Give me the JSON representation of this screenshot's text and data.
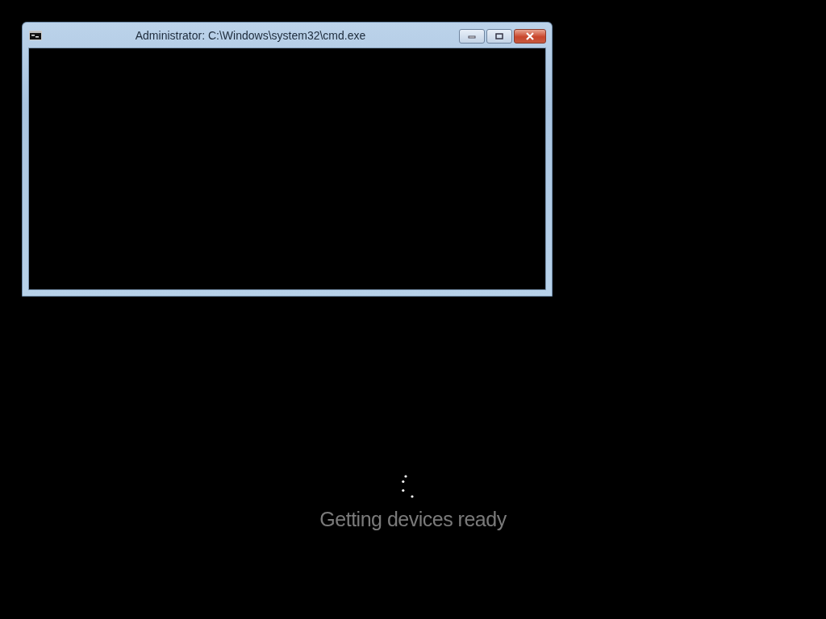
{
  "window": {
    "title": "Administrator: C:\\Windows\\system32\\cmd.exe"
  },
  "status": {
    "message": "Getting devices ready"
  }
}
